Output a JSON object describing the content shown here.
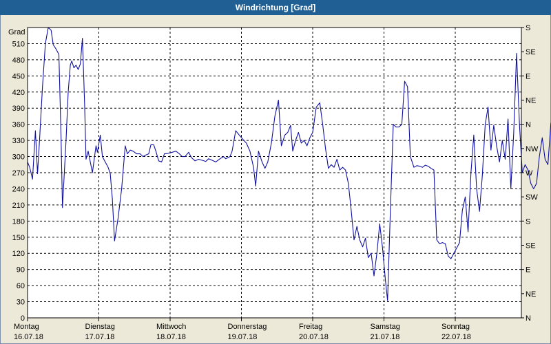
{
  "window": {
    "title": "Windrichtung [Grad]"
  },
  "colors": {
    "titlebar": "#1f5f94",
    "series": "#1010a0",
    "grid": "#000000",
    "plot_bg": "#ffffff",
    "window_bg": "#ece9d8"
  },
  "chart_data": {
    "type": "line",
    "title": "Windrichtung [Grad]",
    "ylabel": "Grad",
    "ylim": [
      0,
      540
    ],
    "yticks": [
      0,
      30,
      60,
      90,
      120,
      150,
      180,
      210,
      240,
      270,
      300,
      330,
      360,
      390,
      420,
      450,
      480,
      510
    ],
    "right_axis_labels": [
      "N",
      "NE",
      "E",
      "SE",
      "S",
      "SW",
      "W",
      "NW",
      "N",
      "NE",
      "E",
      "SE",
      "S"
    ],
    "x_unit_range": [
      0,
      7
    ],
    "x_ticks": [
      {
        "day": "Montag",
        "date": "16.07.18",
        "x": 0
      },
      {
        "day": "Dienstag",
        "date": "17.07.18",
        "x": 1
      },
      {
        "day": "Mittwoch",
        "date": "18.07.18",
        "x": 2
      },
      {
        "day": "Donnerstag",
        "date": "19.07.18",
        "x": 3
      },
      {
        "day": "Freitag",
        "date": "20.07.18",
        "x": 4
      },
      {
        "day": "Samstag",
        "date": "21.07.18",
        "x": 5
      },
      {
        "day": "Sonntag",
        "date": "22.07.18",
        "x": 6
      }
    ],
    "grid": true,
    "series": [
      {
        "points": [
          [
            0.0,
            290
          ],
          [
            0.03,
            280
          ],
          [
            0.07,
            258
          ],
          [
            0.11,
            348
          ],
          [
            0.14,
            268
          ],
          [
            0.17,
            335
          ],
          [
            0.21,
            430
          ],
          [
            0.25,
            510
          ],
          [
            0.29,
            540
          ],
          [
            0.33,
            535
          ],
          [
            0.36,
            508
          ],
          [
            0.4,
            500
          ],
          [
            0.44,
            490
          ],
          [
            0.47,
            338
          ],
          [
            0.49,
            205
          ],
          [
            0.54,
            330
          ],
          [
            0.57,
            420
          ],
          [
            0.6,
            470
          ],
          [
            0.62,
            478
          ],
          [
            0.65,
            465
          ],
          [
            0.68,
            470
          ],
          [
            0.71,
            462
          ],
          [
            0.74,
            472
          ],
          [
            0.77,
            520
          ],
          [
            0.8,
            400
          ],
          [
            0.82,
            295
          ],
          [
            0.85,
            310
          ],
          [
            0.88,
            290
          ],
          [
            0.91,
            270
          ],
          [
            0.94,
            300
          ],
          [
            0.96,
            320
          ],
          [
            0.98,
            308
          ],
          [
            1.02,
            340
          ],
          [
            1.05,
            300
          ],
          [
            1.09,
            290
          ],
          [
            1.13,
            280
          ],
          [
            1.16,
            268
          ],
          [
            1.19,
            220
          ],
          [
            1.22,
            143
          ],
          [
            1.27,
            185
          ],
          [
            1.32,
            240
          ],
          [
            1.37,
            320
          ],
          [
            1.4,
            305
          ],
          [
            1.44,
            312
          ],
          [
            1.48,
            310
          ],
          [
            1.53,
            305
          ],
          [
            1.58,
            305
          ],
          [
            1.62,
            300
          ],
          [
            1.66,
            303
          ],
          [
            1.7,
            305
          ],
          [
            1.73,
            322
          ],
          [
            1.77,
            322
          ],
          [
            1.8,
            310
          ],
          [
            1.84,
            292
          ],
          [
            1.88,
            290
          ],
          [
            1.92,
            305
          ],
          [
            1.97,
            306
          ],
          [
            2.03,
            308
          ],
          [
            2.08,
            310
          ],
          [
            2.13,
            305
          ],
          [
            2.17,
            300
          ],
          [
            2.21,
            300
          ],
          [
            2.26,
            308
          ],
          [
            2.3,
            298
          ],
          [
            2.35,
            292
          ],
          [
            2.4,
            295
          ],
          [
            2.45,
            293
          ],
          [
            2.5,
            291
          ],
          [
            2.54,
            296
          ],
          [
            2.59,
            293
          ],
          [
            2.64,
            290
          ],
          [
            2.7,
            296
          ],
          [
            2.75,
            300
          ],
          [
            2.78,
            296
          ],
          [
            2.84,
            300
          ],
          [
            2.87,
            310
          ],
          [
            2.92,
            348
          ],
          [
            2.97,
            340
          ],
          [
            3.02,
            332
          ],
          [
            3.07,
            325
          ],
          [
            3.12,
            310
          ],
          [
            3.17,
            280
          ],
          [
            3.2,
            245
          ],
          [
            3.24,
            310
          ],
          [
            3.29,
            290
          ],
          [
            3.33,
            278
          ],
          [
            3.37,
            290
          ],
          [
            3.42,
            325
          ],
          [
            3.47,
            375
          ],
          [
            3.52,
            405
          ],
          [
            3.56,
            320
          ],
          [
            3.61,
            340
          ],
          [
            3.65,
            345
          ],
          [
            3.69,
            358
          ],
          [
            3.72,
            310
          ],
          [
            3.76,
            330
          ],
          [
            3.8,
            345
          ],
          [
            3.84,
            325
          ],
          [
            3.88,
            330
          ],
          [
            3.92,
            320
          ],
          [
            3.96,
            335
          ],
          [
            4.0,
            345
          ],
          [
            4.05,
            392
          ],
          [
            4.1,
            400
          ],
          [
            4.14,
            360
          ],
          [
            4.18,
            315
          ],
          [
            4.22,
            278
          ],
          [
            4.26,
            285
          ],
          [
            4.3,
            280
          ],
          [
            4.34,
            295
          ],
          [
            4.38,
            275
          ],
          [
            4.42,
            280
          ],
          [
            4.46,
            275
          ],
          [
            4.5,
            250
          ],
          [
            4.54,
            200
          ],
          [
            4.58,
            145
          ],
          [
            4.62,
            170
          ],
          [
            4.66,
            145
          ],
          [
            4.7,
            132
          ],
          [
            4.74,
            148
          ],
          [
            4.78,
            112
          ],
          [
            4.82,
            120
          ],
          [
            4.86,
            78
          ],
          [
            4.9,
            120
          ],
          [
            4.94,
            175
          ],
          [
            4.98,
            130
          ],
          [
            5.02,
            70
          ],
          [
            5.05,
            32
          ],
          [
            5.09,
            200
          ],
          [
            5.13,
            360
          ],
          [
            5.17,
            355
          ],
          [
            5.21,
            355
          ],
          [
            5.25,
            360
          ],
          [
            5.29,
            440
          ],
          [
            5.33,
            430
          ],
          [
            5.37,
            300
          ],
          [
            5.42,
            280
          ],
          [
            5.46,
            283
          ],
          [
            5.5,
            282
          ],
          [
            5.54,
            280
          ],
          [
            5.58,
            284
          ],
          [
            5.62,
            282
          ],
          [
            5.66,
            278
          ],
          [
            5.7,
            275
          ],
          [
            5.74,
            145
          ],
          [
            5.78,
            138
          ],
          [
            5.82,
            140
          ],
          [
            5.86,
            138
          ],
          [
            5.9,
            115
          ],
          [
            5.94,
            110
          ],
          [
            5.98,
            120
          ],
          [
            6.02,
            130
          ],
          [
            6.06,
            140
          ],
          [
            6.1,
            200
          ],
          [
            6.14,
            225
          ],
          [
            6.18,
            160
          ],
          [
            6.22,
            270
          ],
          [
            6.26,
            340
          ],
          [
            6.3,
            240
          ],
          [
            6.34,
            198
          ],
          [
            6.38,
            265
          ],
          [
            6.42,
            360
          ],
          [
            6.46,
            392
          ],
          [
            6.5,
            312
          ],
          [
            6.54,
            358
          ],
          [
            6.58,
            320
          ],
          [
            6.62,
            290
          ],
          [
            6.66,
            330
          ],
          [
            6.7,
            295
          ],
          [
            6.74,
            370
          ],
          [
            6.78,
            240
          ],
          [
            6.82,
            345
          ],
          [
            6.86,
            492
          ],
          [
            6.9,
            360
          ],
          [
            6.94,
            270
          ],
          [
            6.98,
            285
          ],
          [
            7.02,
            275
          ],
          [
            7.06,
            250
          ],
          [
            7.1,
            240
          ],
          [
            7.14,
            250
          ],
          [
            7.18,
            300
          ],
          [
            7.22,
            335
          ],
          [
            7.26,
            295
          ],
          [
            7.3,
            285
          ],
          [
            7.34,
            360
          ],
          [
            7.38,
            380
          ],
          [
            7.42,
            350
          ],
          [
            7.46,
            320
          ]
        ]
      }
    ]
  }
}
